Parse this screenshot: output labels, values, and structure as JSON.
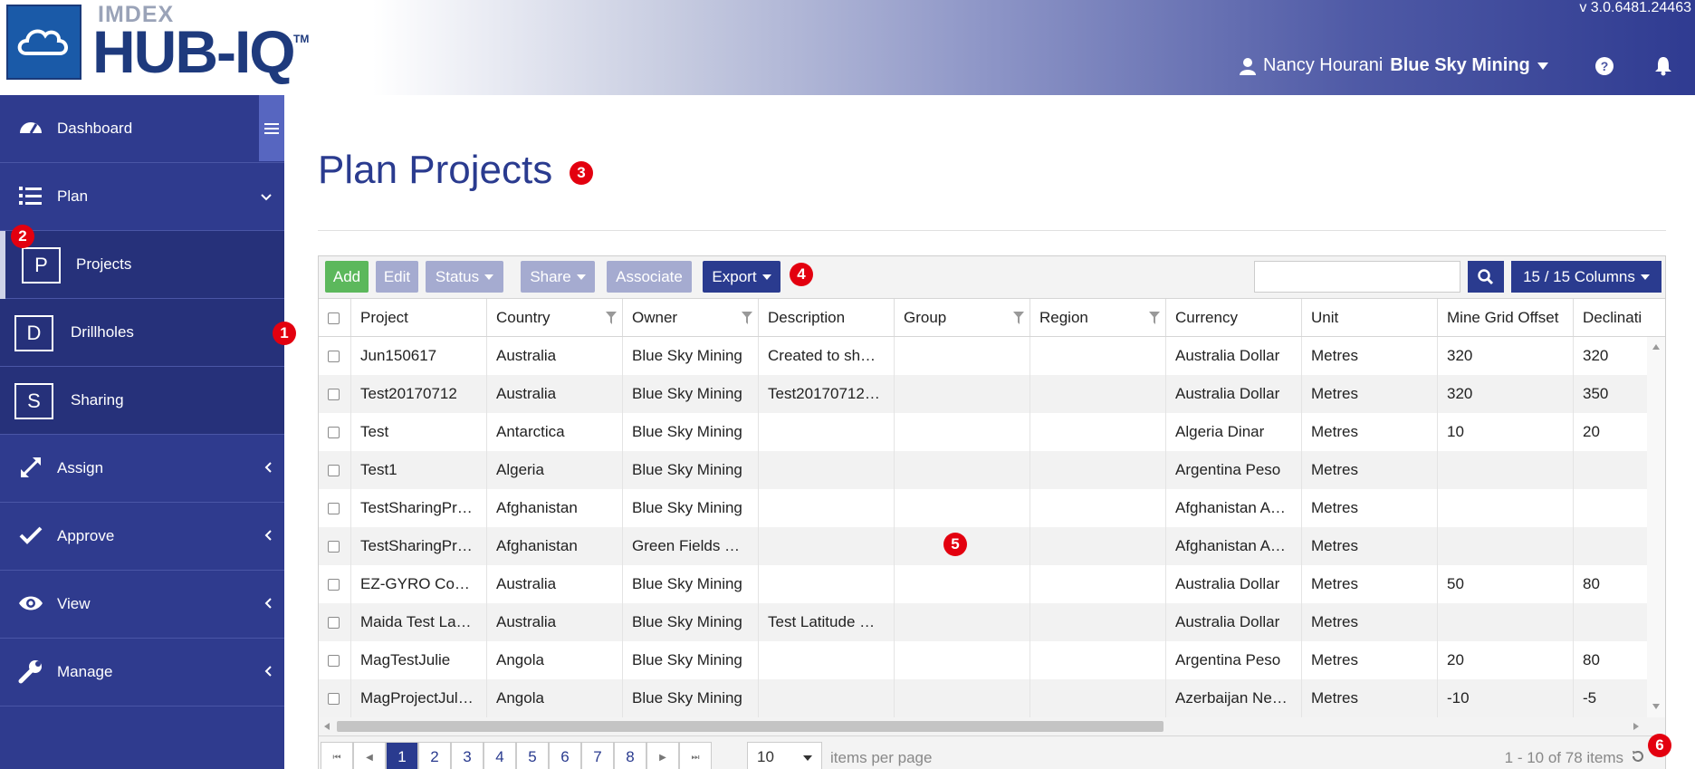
{
  "app": {
    "brand_small": "IMDEX",
    "brand_main": "HUB-IQ",
    "trademark": "TM",
    "version": "v 3.0.6481.24463"
  },
  "header": {
    "user_name": "Nancy Hourani",
    "company": "Blue Sky Mining",
    "icons": [
      "user-icon",
      "caret-down-icon",
      "help-icon",
      "bell-icon"
    ]
  },
  "sidebar": {
    "items": [
      {
        "label": "Dashboard",
        "icon": "dashboard-icon"
      },
      {
        "label": "Plan",
        "icon": "list-icon"
      },
      {
        "label": "Projects",
        "letter": "P"
      },
      {
        "label": "Drillholes",
        "letter": "D"
      },
      {
        "label": "Sharing",
        "letter": "S"
      },
      {
        "label": "Assign",
        "icon": "expand-arrows-icon"
      },
      {
        "label": "Approve",
        "icon": "check-icon"
      },
      {
        "label": "View",
        "icon": "eye-icon"
      },
      {
        "label": "Manage",
        "icon": "wrench-icon"
      }
    ]
  },
  "page": {
    "title": "Plan Projects"
  },
  "badges": [
    "1",
    "2",
    "3",
    "4",
    "5",
    "6"
  ],
  "toolbar": {
    "add": "Add",
    "edit": "Edit",
    "status": "Status",
    "share": "Share",
    "associate": "Associate",
    "export": "Export",
    "search_value": "",
    "columns": "15 / 15 Columns"
  },
  "colors": {
    "primary": "#2a3b8f",
    "sidebar": "#2f3b8e",
    "add": "#5cb85c",
    "disabled": "#a5abd0",
    "badge": "#e3000f"
  },
  "table": {
    "columns": [
      "Project",
      "Country",
      "Owner",
      "Description",
      "Group",
      "Region",
      "Currency",
      "Unit",
      "Mine Grid Offset",
      "Declinati"
    ],
    "rows": [
      [
        "Jun150617",
        "Australia",
        "Blue Sky Mining",
        "Created to sh…",
        "",
        "",
        "Australia Dollar",
        "Metres",
        "320",
        "320"
      ],
      [
        "Test20170712",
        "Australia",
        "Blue Sky Mining",
        "Test20170712…",
        "",
        "",
        "Australia Dollar",
        "Metres",
        "320",
        "350"
      ],
      [
        "Test",
        "Antarctica",
        "Blue Sky Mining",
        "",
        "",
        "",
        "Algeria Dinar",
        "Metres",
        "10",
        "20"
      ],
      [
        "Test1",
        "Algeria",
        "Blue Sky Mining",
        "",
        "",
        "",
        "Argentina Peso",
        "Metres",
        "",
        ""
      ],
      [
        "TestSharingPr…",
        "Afghanistan",
        "Blue Sky Mining",
        "",
        "",
        "",
        "Afghanistan A…",
        "Metres",
        "",
        ""
      ],
      [
        "TestSharingPr…",
        "Afghanistan",
        "Green Fields …",
        "",
        "",
        "",
        "Afghanistan A…",
        "Metres",
        "",
        ""
      ],
      [
        "EZ-GYRO Co…",
        "Australia",
        "Blue Sky Mining",
        "",
        "",
        "",
        "Australia Dollar",
        "Metres",
        "50",
        "80"
      ],
      [
        "Maida Test La…",
        "Australia",
        "Blue Sky Mining",
        "Test Latitude …",
        "",
        "",
        "Australia Dollar",
        "Metres",
        "",
        ""
      ],
      [
        "MagTestJulie",
        "Angola",
        "Blue Sky Mining",
        "",
        "",
        "",
        "Argentina Peso",
        "Metres",
        "20",
        "80"
      ],
      [
        "MagProjectJul…",
        "Angola",
        "Blue Sky Mining",
        "",
        "",
        "",
        "Azerbaijan Ne…",
        "Metres",
        "-10",
        "-5"
      ]
    ]
  },
  "pager": {
    "pages": [
      "1",
      "2",
      "3",
      "4",
      "5",
      "6",
      "7",
      "8"
    ],
    "current": "1",
    "first": "⏮",
    "prev": "◀",
    "next": "▶",
    "last": "⏭",
    "per_page": "10",
    "per_page_label": "items per page",
    "info": "1 - 10 of 78 items"
  }
}
